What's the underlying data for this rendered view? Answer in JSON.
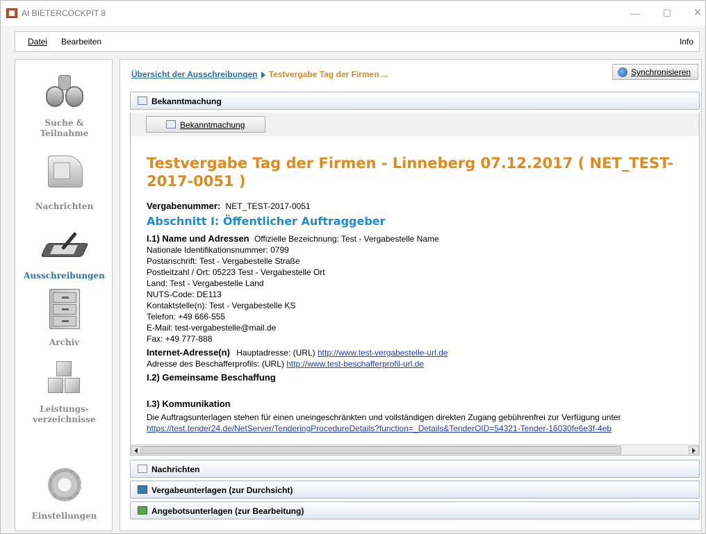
{
  "window": {
    "title": "AI BIETERCOCKPIT 8",
    "min_glyph": "—",
    "max_glyph": "☐",
    "close_glyph": "✕"
  },
  "menu": {
    "datei": "Datei",
    "bearbeiten": "Bearbeiten",
    "info": "Info"
  },
  "nav": [
    {
      "label_1": "Suche &",
      "label_2": "Teilnahme",
      "icon": "binoculars-icon"
    },
    {
      "label_1": "Nachrichten",
      "icon": "mailbox-icon"
    },
    {
      "label_1": "Ausschreibungen",
      "icon": "tablet-pen-icon",
      "active": true
    },
    {
      "label_1": "Archiv",
      "icon": "file-cabinet-icon"
    },
    {
      "label_1": "Leistungs-",
      "label_2": "verzeichnisse",
      "icon": "cubes-icon"
    },
    {
      "label_1": "Einstellungen",
      "icon": "gear-icon"
    }
  ],
  "breadcrumb": {
    "link": "Übersicht der Ausschreibungen",
    "current": "Testvergabe Tag der Firmen ..."
  },
  "sync_button": "Synchronisieren",
  "sections": {
    "bekanntmachung": "Bekanntmachung",
    "nachrichten": "Nachrichten",
    "vergabeunterlagen": "Vergabeunterlagen (zur Durchsicht)",
    "angebotsunterlagen": "Angebotsunterlagen (zur Bearbeitung)"
  },
  "inner_button": "Bekanntmachung",
  "document": {
    "title": "Testvergabe Tag der Firmen - Linneberg 07.12.2017  ( NET_TEST-2017-0051 )",
    "vergabenummer_label": "Vergabenummer:",
    "vergabenummer_value": "NET_TEST-2017-0051",
    "abschnitt": "Abschnitt I: Öffentlicher Auftraggeber",
    "i1_heading": "I.1) Name und Adressen",
    "i1_bezeichnung": "Offizielle Bezeichnung: Test - Vergabestelle Name",
    "lines": [
      "Nationale Identifikationsnummer: 0799",
      "Postanschrift: Test - Vergabestelle Straße",
      "Postleitzahl / Ort: 05223 Test - Vergabestelle Ort",
      "Land: Test - Vergabestelle Land",
      "NUTS-Code: DE113",
      "Kontaktstelle(n): Test - Vergabestelle KS",
      "Telefon: +49 666-555",
      "E-Mail: test-vergabestelle@mail.de",
      "Fax: +49 777-888"
    ],
    "internet_heading": "Internet-Adresse(n)",
    "haupt_label": "Hauptadresse: (URL)",
    "haupt_url": "http://www.test-vergabestelle-url.de",
    "profil_label": "Adresse des Beschafferprofils: (URL)",
    "profil_url": "http://www.test-beschafferprofil-url.de",
    "i2_heading": "I.2) Gemeinsame Beschaffung",
    "i3_heading": "I.3) Kommunikation",
    "i3_text": "Die Auftragsunterlagen stehen für einen uneingeschränkten und vollständigen direkten Zugang gebührenfrei zur Verfügung unter",
    "i3_url": "https://test.tender24.de/NetServer/TenderingProcedureDetails?function=_Details&TenderOID=54321-Tender-16030fe6e3f-4eb"
  }
}
